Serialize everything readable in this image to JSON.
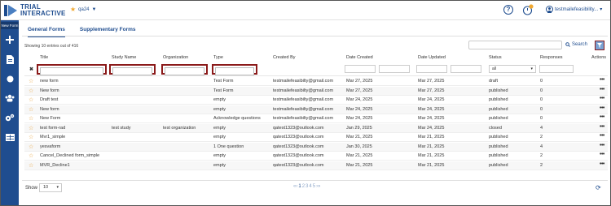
{
  "app": {
    "logo_line1": "TRIAL",
    "logo_line2": "INTERACTIVE",
    "project_name": "qa24",
    "user_email": "testmailefeasibility...",
    "help_label": "?"
  },
  "sidebar": {
    "new_form_label": "New Form",
    "icons": [
      "plus-icon",
      "document-icon",
      "circle-icon",
      "users-icon",
      "gears-icon",
      "table-icon"
    ]
  },
  "tabs": [
    {
      "label": "General Forms",
      "active": true
    },
    {
      "label": "Supplementary Forms",
      "active": false
    }
  ],
  "entries_info": "Showing 10 entries out of 416",
  "search": {
    "button_label": "Search",
    "value": ""
  },
  "table": {
    "columns": [
      "Title",
      "Study Name",
      "Organization",
      "Type",
      "Created By",
      "Date Created",
      "Date Updated",
      "Status",
      "Responses",
      "Actions"
    ],
    "filter_status": "all",
    "clear_label": "✖",
    "rows": [
      {
        "title": "new form",
        "study": "",
        "org": "",
        "type": "Test Form",
        "created_by": "testmailefeasibilty@gmail.com",
        "date_created": "Mar 27, 2025",
        "date_updated": "Mar 27, 2025",
        "status": "draft",
        "responses": "0"
      },
      {
        "title": "New form",
        "study": "",
        "org": "",
        "type": "Test Form",
        "created_by": "testmailefeasibilty@gmail.com",
        "date_created": "Mar 27, 2025",
        "date_updated": "Mar 27, 2025",
        "status": "published",
        "responses": "0"
      },
      {
        "title": "Draft test",
        "study": "",
        "org": "",
        "type": "empty",
        "created_by": "testmailefeasibilty@gmail.com",
        "date_created": "Mar 24, 2025",
        "date_updated": "Mar 24, 2025",
        "status": "published",
        "responses": "0"
      },
      {
        "title": "New form",
        "study": "",
        "org": "",
        "type": "empty",
        "created_by": "testmailefeasibilty@gmail.com",
        "date_created": "Mar 24, 2025",
        "date_updated": "Mar 24, 2025",
        "status": "published",
        "responses": "0"
      },
      {
        "title": "New Form",
        "study": "",
        "org": "",
        "type": "Acknowledge questions",
        "created_by": "testmailefeasibilty@gmail.com",
        "date_created": "Mar 24, 2025",
        "date_updated": "Mar 24, 2025",
        "status": "published",
        "responses": "0"
      },
      {
        "title": "test form-rad",
        "study": "test study",
        "org": "test organization",
        "type": "empty",
        "created_by": "qatest1323@outlook.com",
        "date_created": "Jan 29, 2025",
        "date_updated": "Mar 24, 2025",
        "status": "closed",
        "responses": "4"
      },
      {
        "title": "Mvr1_simple",
        "study": "",
        "org": "",
        "type": "empty",
        "created_by": "qatest1323@outlook.com",
        "date_created": "Mar 21, 2025",
        "date_updated": "Mar 21, 2025",
        "status": "published",
        "responses": "2"
      },
      {
        "title": "yesvaform",
        "study": "",
        "org": "",
        "type": "1 One question",
        "created_by": "qatest1323@outlook.com",
        "date_created": "Jan 30, 2025",
        "date_updated": "Mar 21, 2025",
        "status": "published",
        "responses": "4"
      },
      {
        "title": "Cancel_Declined form_simple",
        "study": "",
        "org": "",
        "type": "empty",
        "created_by": "qatest1323@outlook.com",
        "date_created": "Mar 21, 2025",
        "date_updated": "Mar 21, 2025",
        "status": "published",
        "responses": "2"
      },
      {
        "title": "MVR_Decline1",
        "study": "",
        "org": "",
        "type": "empty",
        "created_by": "qatest1323@outlook.com",
        "date_created": "Mar 21, 2025",
        "date_updated": "Mar 21, 2025",
        "status": "published",
        "responses": "2"
      }
    ]
  },
  "footer": {
    "show_label": "Show",
    "page_size": "10",
    "pager_prev": "«‹",
    "pages": [
      "1",
      "2",
      "3",
      "4",
      "5"
    ],
    "pager_next": "›»"
  },
  "colors": {
    "brand": "#1f4d8f",
    "highlight": "#8b1a1a",
    "star": "#e8a23a"
  }
}
